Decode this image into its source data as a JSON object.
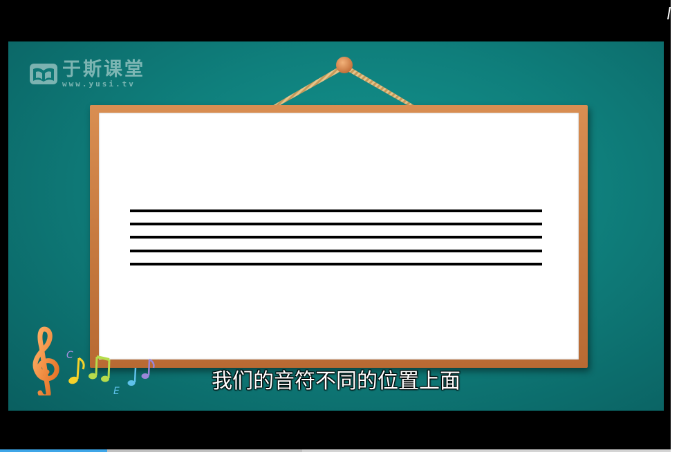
{
  "logo": {
    "title": "于斯课堂",
    "url": "www.yusi.tv"
  },
  "video": {
    "subtitle": "我们的音符不同的位置上面",
    "staff_line_count": 5
  },
  "decoration": {
    "note_letters": [
      "C",
      "E"
    ]
  },
  "progress": {
    "played_fraction": 0.16,
    "buffered_fraction": 0.45
  },
  "colors": {
    "background_teal": "#0f7f7c",
    "frame_brown": "#c77a40",
    "progress_played": "#3ea6e8",
    "subtitle_text": "#ffffff"
  }
}
